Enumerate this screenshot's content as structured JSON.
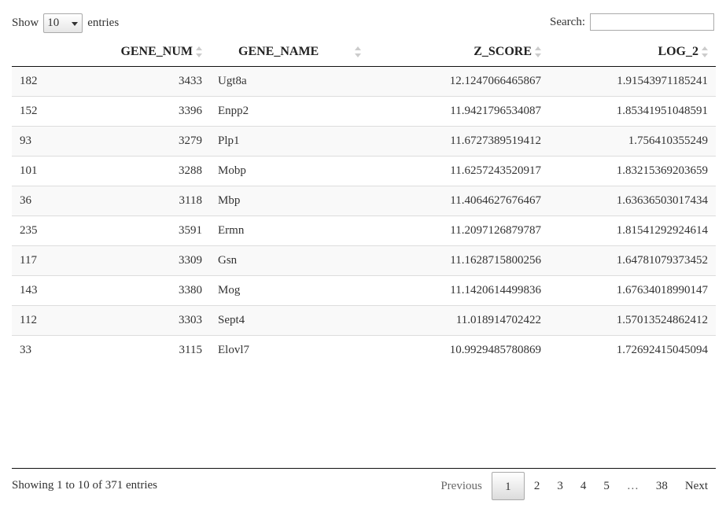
{
  "controls": {
    "show_label": "Show",
    "page_length": "10",
    "entries_label": "entries",
    "search_label": "Search:",
    "search_value": ""
  },
  "table": {
    "columns": [
      "",
      "GENE_NUM",
      "GENE_NAME",
      "Z_SCORE",
      "LOG_2"
    ],
    "rows": [
      [
        "182",
        "3433",
        "Ugt8a",
        "12.1247066465867",
        "1.91543971185241"
      ],
      [
        "152",
        "3396",
        "Enpp2",
        "11.9421796534087",
        "1.85341951048591"
      ],
      [
        "93",
        "3279",
        "Plp1",
        "11.6727389519412",
        "1.756410355249"
      ],
      [
        "101",
        "3288",
        "Mobp",
        "11.6257243520917",
        "1.83215369203659"
      ],
      [
        "36",
        "3118",
        "Mbp",
        "11.4064627676467",
        "1.63636503017434"
      ],
      [
        "235",
        "3591",
        "Ermn",
        "11.2097126879787",
        "1.81541292924614"
      ],
      [
        "117",
        "3309",
        "Gsn",
        "11.1628715800256",
        "1.64781079373452"
      ],
      [
        "143",
        "3380",
        "Mog",
        "11.1420614499836",
        "1.67634018990147"
      ],
      [
        "112",
        "3303",
        "Sept4",
        "11.018914702422",
        "1.57013524862412"
      ],
      [
        "33",
        "3115",
        "Elovl7",
        "10.9929485780869",
        "1.72692415045094"
      ]
    ]
  },
  "footer": {
    "info": "Showing 1 to 10 of 371 entries",
    "pagination": {
      "previous": "Previous",
      "pages": [
        "1",
        "2",
        "3",
        "4",
        "5"
      ],
      "ellipsis": "…",
      "last_page": "38",
      "next": "Next",
      "current": "1"
    }
  }
}
